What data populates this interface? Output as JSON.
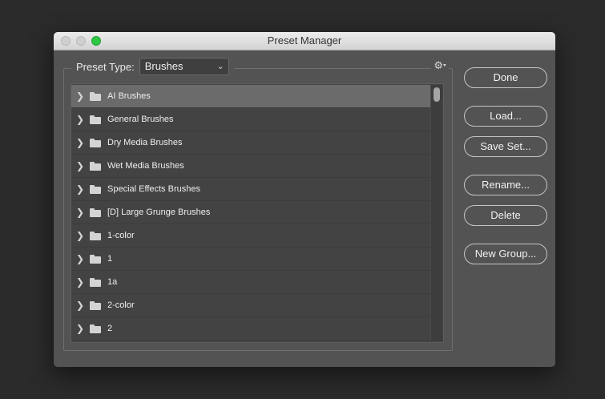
{
  "window": {
    "title": "Preset Manager"
  },
  "preset_type": {
    "label": "Preset Type:",
    "selected": "Brushes"
  },
  "list": {
    "items": [
      {
        "label": "AI Brushes",
        "selected": true
      },
      {
        "label": "General Brushes",
        "selected": false
      },
      {
        "label": "Dry Media Brushes",
        "selected": false
      },
      {
        "label": "Wet Media Brushes",
        "selected": false
      },
      {
        "label": "Special Effects Brushes",
        "selected": false
      },
      {
        "label": "[D] Large Grunge Brushes",
        "selected": false
      },
      {
        "label": "1-color",
        "selected": false
      },
      {
        "label": "1",
        "selected": false
      },
      {
        "label": "1a",
        "selected": false
      },
      {
        "label": "2-color",
        "selected": false
      },
      {
        "label": "2",
        "selected": false
      }
    ]
  },
  "buttons": {
    "done": "Done",
    "load": "Load...",
    "save_set": "Save Set...",
    "rename": "Rename...",
    "delete": "Delete",
    "new_group": "New Group..."
  },
  "icons": {
    "gear": "gear-icon",
    "folder": "folder-icon",
    "chevron": "chevron-right-icon"
  },
  "colors": {
    "window_bg": "#535353",
    "list_bg": "#434343",
    "selected_row": "#6b6b6b",
    "zoom_button": "#2ec743"
  }
}
